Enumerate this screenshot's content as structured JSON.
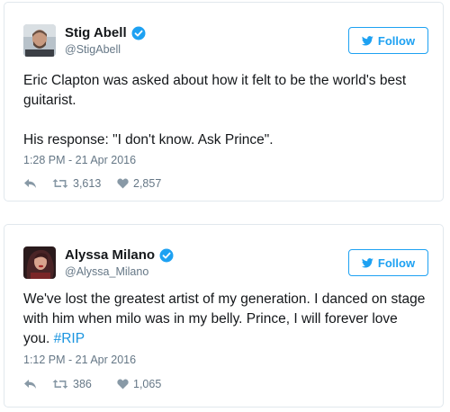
{
  "tweets": [
    {
      "display_name": "Stig Abell",
      "handle": "@StigAbell",
      "follow_label": "Follow",
      "text_paragraphs": [
        "Eric Clapton was asked about how it felt to be the world's best guitarist.",
        "His response: \"I don't know. Ask Prince\"."
      ],
      "timestamp": "1:28 PM - 21 Apr 2016",
      "retweets": "3,613",
      "likes": "2,857"
    },
    {
      "display_name": "Alyssa Milano",
      "handle": "@Alyssa_Milano",
      "follow_label": "Follow",
      "text_before_hashtag": "We've lost the greatest artist of my generation. I danced on stage with him when milo was in my belly. Prince, I will forever love you. ",
      "hashtag": "#RIP",
      "timestamp": "1:12 PM - 21 Apr 2016",
      "retweets": "386",
      "likes": "1,065"
    }
  ],
  "colors": {
    "accent": "#1da1f2",
    "hashtag": "#1b95e0",
    "muted": "#657786",
    "icon": "#8899a6",
    "border": "#e1e8ed"
  },
  "icons": {
    "verified": "verified-badge-icon",
    "follow": "twitter-bird-icon",
    "reply": "reply-arrow-icon",
    "retweet": "retweet-icon",
    "like": "heart-icon"
  }
}
